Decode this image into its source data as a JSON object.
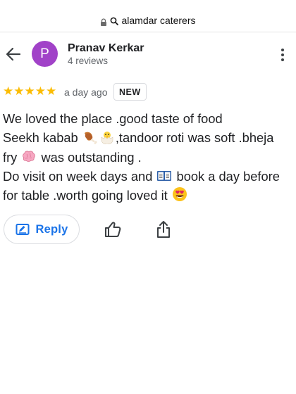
{
  "browser": {
    "url_text": "alamdar caterers",
    "icons": [
      "lock-icon",
      "search-icon"
    ]
  },
  "review": {
    "reviewer": {
      "avatar_initial": "P",
      "name": "Pranav Kerkar",
      "review_count": "4 reviews"
    },
    "rating": 5,
    "rating_max": 5,
    "time": "a day ago",
    "badge": "NEW",
    "text": {
      "line1": "We loved the place .good taste of food",
      "line2_a": "Seekh kabab ",
      "line2_b": ",tandoor roti was soft .bheja",
      "line3_a": "fry ",
      "line3_b": " was outstanding .",
      "line4_a": "Do visit on week days and ",
      "line4_b": " book a day before",
      "line5_a": "for table .worth going loved it "
    },
    "emojis": [
      "poultry-leg-emoji",
      "hatching-chick-emoji",
      "brain-emoji",
      "open-book-emoji",
      "heart-eyes-emoji"
    ]
  },
  "actions": {
    "reply_label": "Reply",
    "icons": [
      "back-arrow-icon",
      "more-vert-icon",
      "reply-edit-icon",
      "thumbs-up-icon",
      "share-icon"
    ]
  },
  "colors": {
    "avatar": "#a142c8",
    "star": "#fbbc04",
    "accent": "#1a73e8",
    "text": "#202124",
    "secondary_text": "#5f6368"
  }
}
